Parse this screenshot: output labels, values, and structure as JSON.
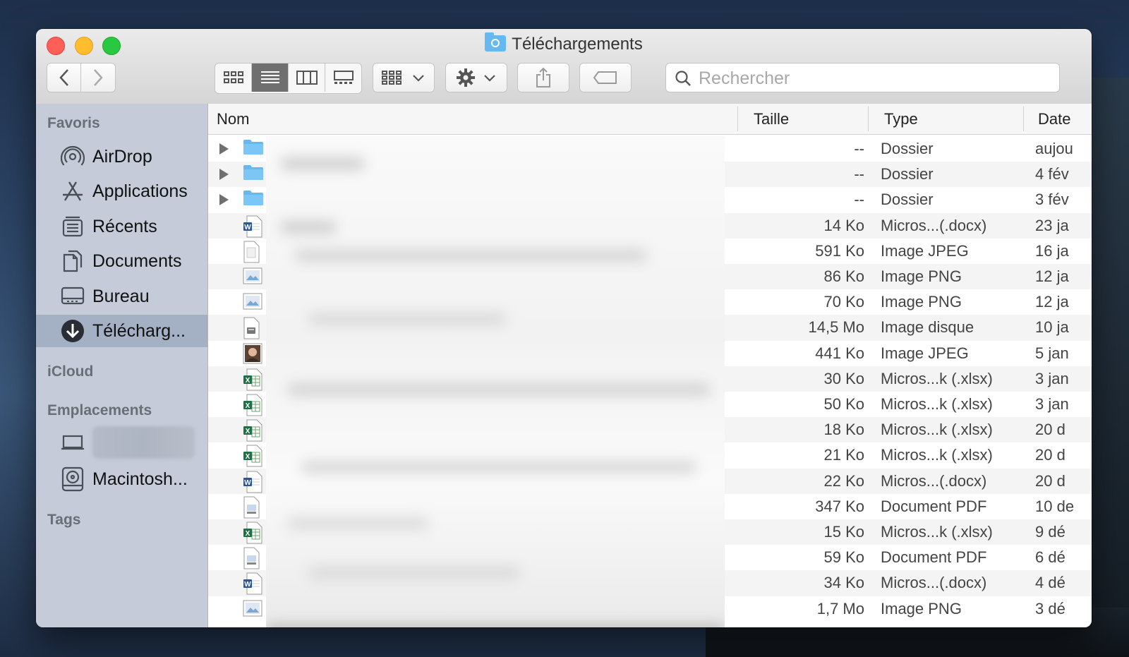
{
  "window": {
    "title": "Téléchargements"
  },
  "toolbar": {
    "back_icon": "chevron-left-icon",
    "forward_icon": "chevron-right-icon",
    "views": [
      "icon-view-icon",
      "list-view-icon",
      "column-view-icon",
      "gallery-view-icon"
    ],
    "active_view": "list-view-icon",
    "group_icon": "group-by-icon",
    "action_icon": "gear-icon",
    "share_icon": "share-icon",
    "tag_icon": "tag-icon"
  },
  "search": {
    "placeholder": "Rechercher",
    "value": ""
  },
  "sidebar": {
    "sections": {
      "favoris": "Favoris",
      "icloud": "iCloud",
      "emplacements": "Emplacements",
      "tags": "Tags"
    },
    "favorites": [
      {
        "label": "AirDrop",
        "icon": "airdrop-icon"
      },
      {
        "label": "Applications",
        "icon": "applications-icon"
      },
      {
        "label": "Récents",
        "icon": "recents-icon"
      },
      {
        "label": "Documents",
        "icon": "documents-icon"
      },
      {
        "label": "Bureau",
        "icon": "desktop-icon"
      },
      {
        "label": "Télécharg...",
        "icon": "downloads-icon",
        "selected": true
      }
    ],
    "locations": [
      {
        "label": "",
        "icon": "laptop-icon"
      },
      {
        "label": "Macintosh...",
        "icon": "hard-drive-icon"
      }
    ]
  },
  "columns": {
    "name": "Nom",
    "size": "Taille",
    "type": "Type",
    "date": "Date"
  },
  "files": [
    {
      "kind": "folder",
      "size": "--",
      "type": "Dossier",
      "date": "aujou"
    },
    {
      "kind": "folder",
      "size": "--",
      "type": "Dossier",
      "date": "4 fév"
    },
    {
      "kind": "folder",
      "size": "--",
      "type": "Dossier",
      "date": "3 fév"
    },
    {
      "kind": "word",
      "size": "14 Ko",
      "type": "Micros...(.docx)",
      "date": "23 ja"
    },
    {
      "kind": "doc",
      "size": "591 Ko",
      "type": "Image JPEG",
      "date": "16 ja"
    },
    {
      "kind": "image",
      "size": "86 Ko",
      "type": "Image PNG",
      "date": "12 ja"
    },
    {
      "kind": "image",
      "size": "70 Ko",
      "type": "Image PNG",
      "date": "12 ja"
    },
    {
      "kind": "disk",
      "size": "14,5 Mo",
      "type": "Image disque",
      "date": "10 ja"
    },
    {
      "kind": "photo",
      "size": "441 Ko",
      "type": "Image JPEG",
      "date": "5 jan"
    },
    {
      "kind": "excel",
      "size": "30 Ko",
      "type": "Micros...k (.xlsx)",
      "date": "3 jan"
    },
    {
      "kind": "excel",
      "size": "50 Ko",
      "type": "Micros...k (.xlsx)",
      "date": "3 jan"
    },
    {
      "kind": "excel",
      "size": "18 Ko",
      "type": "Micros...k (.xlsx)",
      "date": "20 d"
    },
    {
      "kind": "excel",
      "size": "21 Ko",
      "type": "Micros...k (.xlsx)",
      "date": "20 d"
    },
    {
      "kind": "word",
      "size": "22 Ko",
      "type": "Micros...(.docx)",
      "date": "20 d"
    },
    {
      "kind": "pdf",
      "size": "347 Ko",
      "type": "Document PDF",
      "date": "10 de"
    },
    {
      "kind": "excel",
      "size": "15 Ko",
      "type": "Micros...k (.xlsx)",
      "date": "9 dé"
    },
    {
      "kind": "pdf",
      "size": "59 Ko",
      "type": "Document PDF",
      "date": "6 dé"
    },
    {
      "kind": "word",
      "size": "34 Ko",
      "type": "Micros...(.docx)",
      "date": "4 dé"
    },
    {
      "kind": "image",
      "size": "1,7 Mo",
      "type": "Image PNG",
      "date": "3 dé"
    }
  ],
  "colors": {
    "sidebar_bg": "#c5cbd8",
    "selected_bg": "#a4b0c4",
    "folder": "#66b9f0",
    "excel": "#1e7145",
    "word": "#2b579a"
  }
}
